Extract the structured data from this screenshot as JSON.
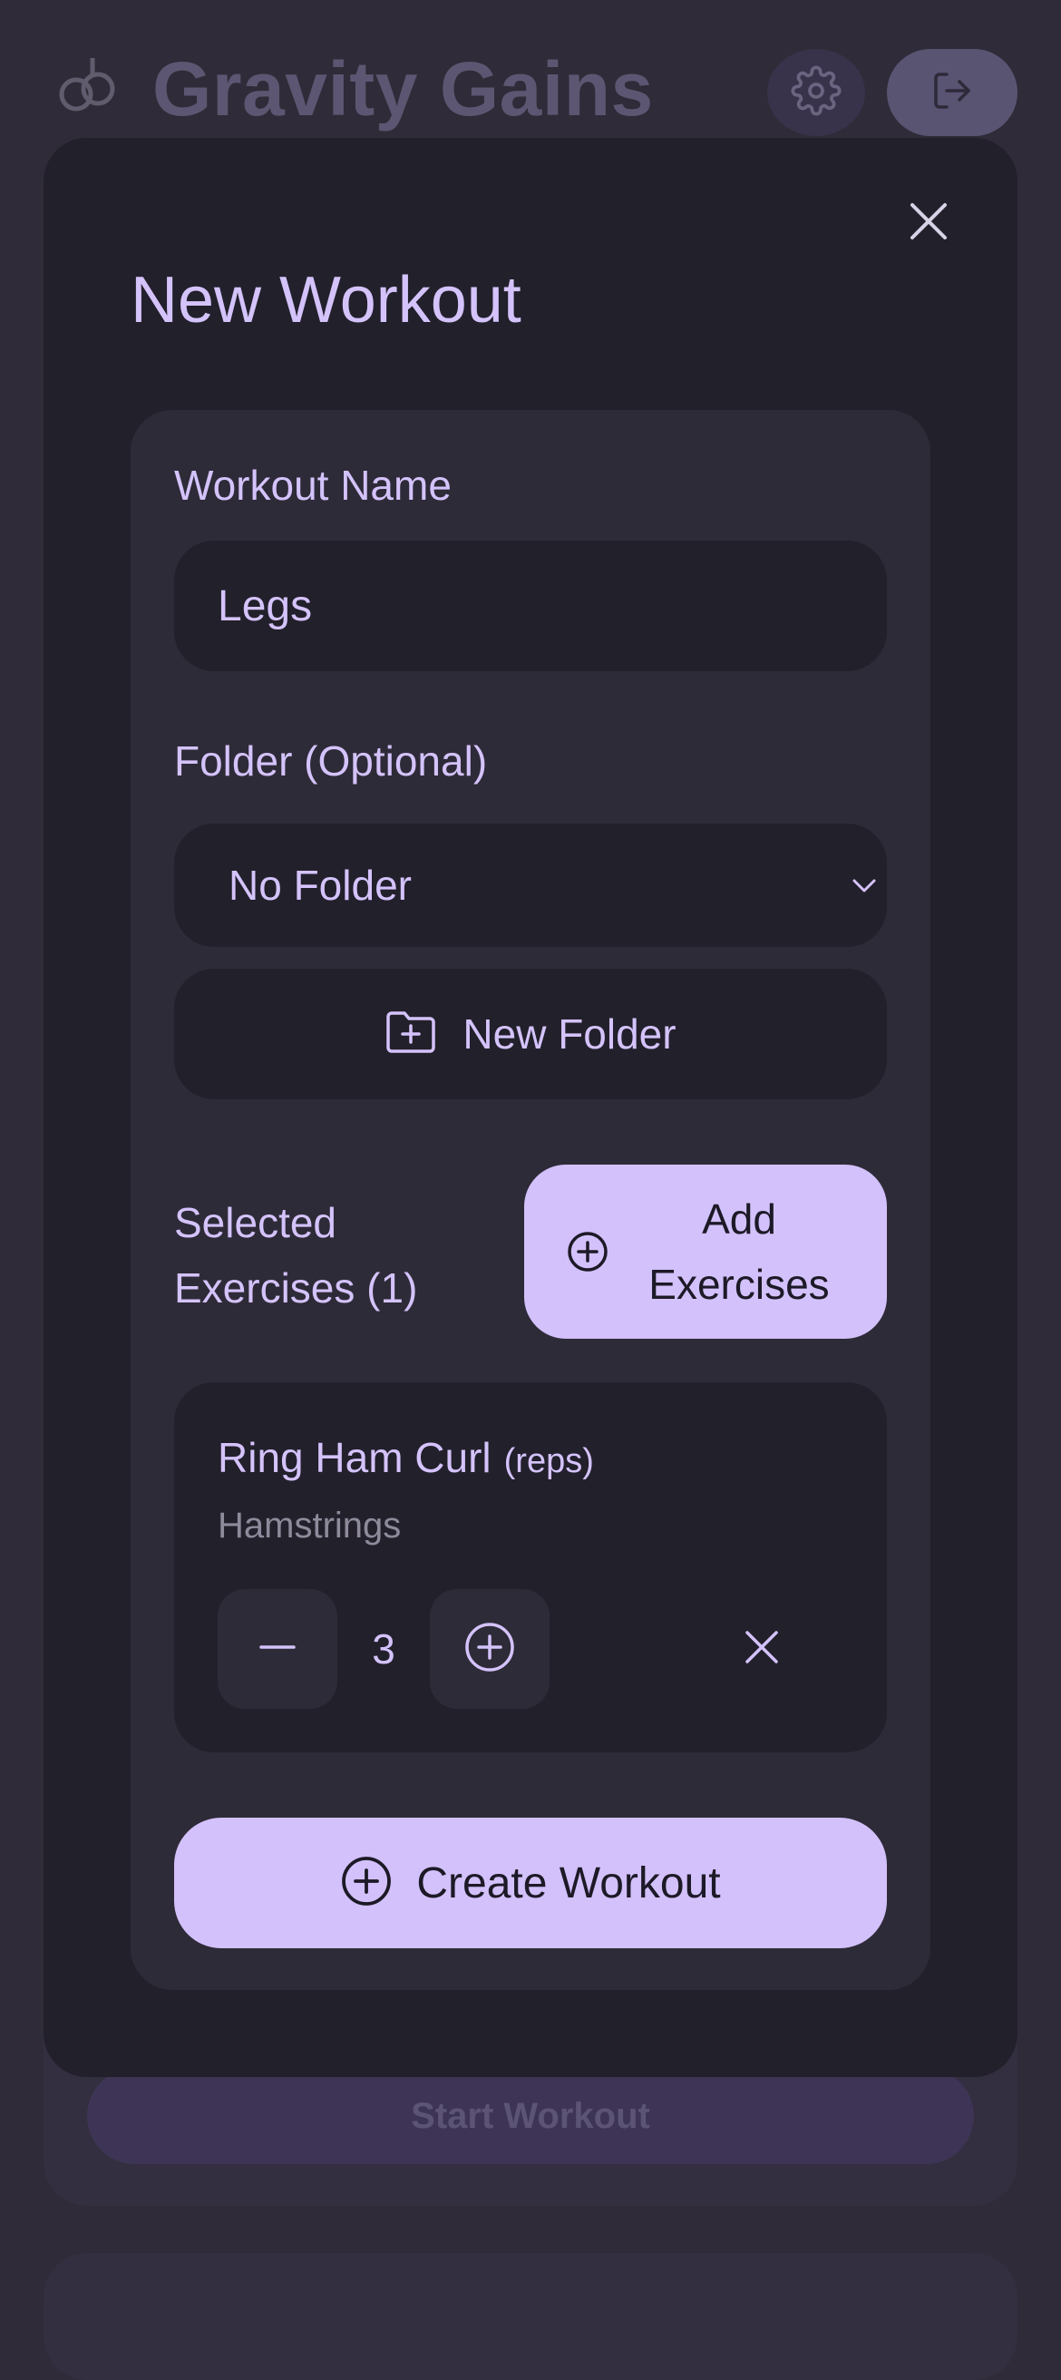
{
  "app": {
    "title": "Gravity Gains",
    "logo_icon": "gymnastic-rings-icon",
    "settings_icon": "gear-icon",
    "logout_icon": "logout-icon",
    "start_workout_label": "Start Workout"
  },
  "modal": {
    "title": "New Workout",
    "close_icon": "close-icon",
    "workout_name": {
      "label": "Workout Name",
      "value": "Legs"
    },
    "folder": {
      "label": "Folder (Optional)",
      "selected": "No Folder",
      "new_folder_label": "New Folder"
    },
    "selected_exercises": {
      "label": "Selected Exercises (1)",
      "add_label": "Add Exercises"
    },
    "exercises": [
      {
        "name": "Ring Ham Curl",
        "type": "(reps)",
        "muscle": "Hamstrings",
        "sets": "3"
      }
    ],
    "create_label": "Create Workout"
  },
  "colors": {
    "accent": "#d3c1fb",
    "modal_bg": "#22202b",
    "card_bg": "#2e2b38",
    "page_bg": "#2f2b38"
  }
}
